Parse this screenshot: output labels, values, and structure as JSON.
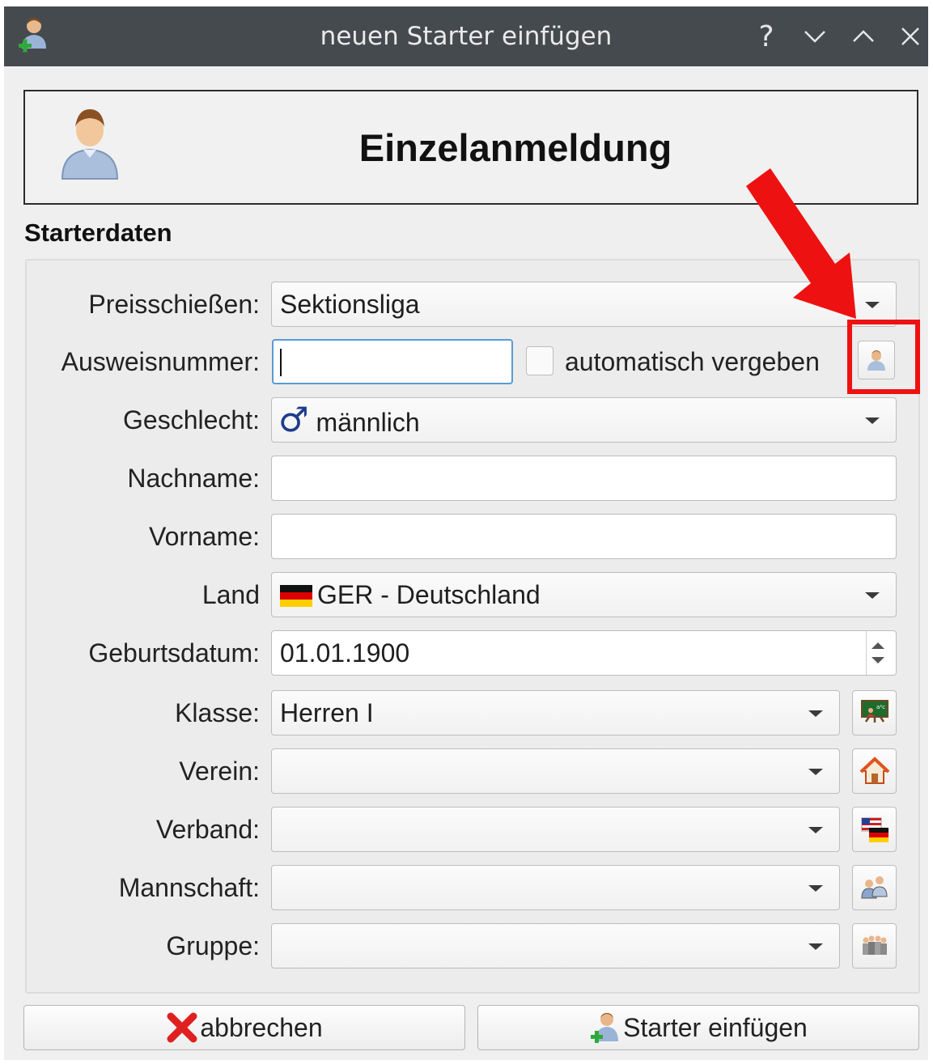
{
  "window": {
    "title": "neuen Starter einfügen",
    "help_label": "?"
  },
  "header": {
    "heading": "Einzelanmeldung"
  },
  "section": {
    "title": "Starterdaten"
  },
  "form": {
    "preisschiessen": {
      "label": "Preisschießen:",
      "value": "Sektionsliga"
    },
    "ausweisnummer": {
      "label": "Ausweisnummer:",
      "value": "",
      "auto_label": "automatisch vergeben",
      "auto_checked": false
    },
    "geschlecht": {
      "label": "Geschlecht:",
      "symbol": "♂",
      "value": "männlich"
    },
    "nachname": {
      "label": "Nachname:",
      "value": ""
    },
    "vorname": {
      "label": "Vorname:",
      "value": ""
    },
    "land": {
      "label": "Land",
      "value": "GER - Deutschland"
    },
    "geburtsdatum": {
      "label": "Geburtsdatum:",
      "value": "01.01.1900"
    },
    "klasse": {
      "label": "Klasse:",
      "value": "Herren I"
    },
    "verein": {
      "label": "Verein:",
      "value": ""
    },
    "verband": {
      "label": "Verband:",
      "value": ""
    },
    "mannschaft": {
      "label": "Mannschaft:",
      "value": ""
    },
    "gruppe": {
      "label": "Gruppe:",
      "value": ""
    }
  },
  "buttons": {
    "cancel": "abbrechen",
    "submit": "Starter einfügen"
  },
  "colors": {
    "titlebar": "#454a4f",
    "annotation_red": "#ee1111",
    "focus_blue": "#5b9bd5"
  }
}
